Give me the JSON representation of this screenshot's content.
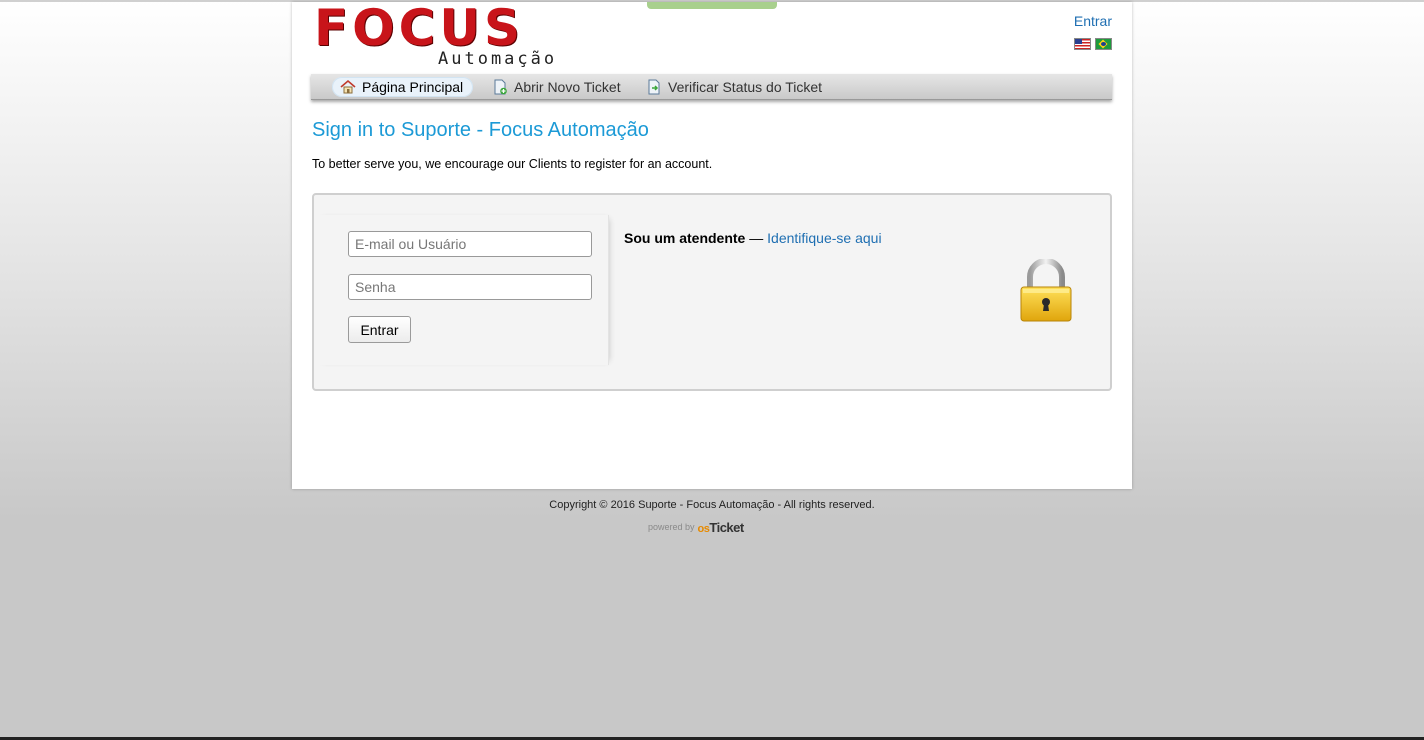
{
  "header": {
    "logo_main": "FOCUS",
    "logo_sub": "Automação",
    "signin_label": "Entrar",
    "languages": [
      {
        "icon": "us-flag-icon",
        "code": "en"
      },
      {
        "icon": "brazil-flag-icon",
        "code": "pt_BR"
      }
    ]
  },
  "nav": {
    "items": [
      {
        "label": "Página Principal",
        "icon": "home-icon",
        "active": true
      },
      {
        "label": "Abrir Novo Ticket",
        "icon": "new-ticket-icon",
        "active": false
      },
      {
        "label": "Verificar Status do Ticket",
        "icon": "ticket-status-icon",
        "active": false
      }
    ]
  },
  "main": {
    "title": "Sign in to Suporte - Focus Automação",
    "intro": "To better serve you, we encourage our Clients to register for an account.",
    "login": {
      "username_placeholder": "E-mail ou Usuário",
      "password_placeholder": "Senha",
      "submit_label": "Entrar"
    },
    "agent": {
      "prefix": "Sou um atendente",
      "separator": " — ",
      "link_label": "Identifique-se aqui"
    }
  },
  "footer": {
    "copyright": "Copyright © 2016 Suporte - Focus Automação - All rights reserved.",
    "powered_by": "powered by",
    "brand_os": "os",
    "brand_ticket": "Ticket"
  },
  "colors": {
    "title": "#1c9ad6",
    "link": "#1f6fb2",
    "logo_red": "#c8141a",
    "lock_gold": "#f2c21b"
  }
}
